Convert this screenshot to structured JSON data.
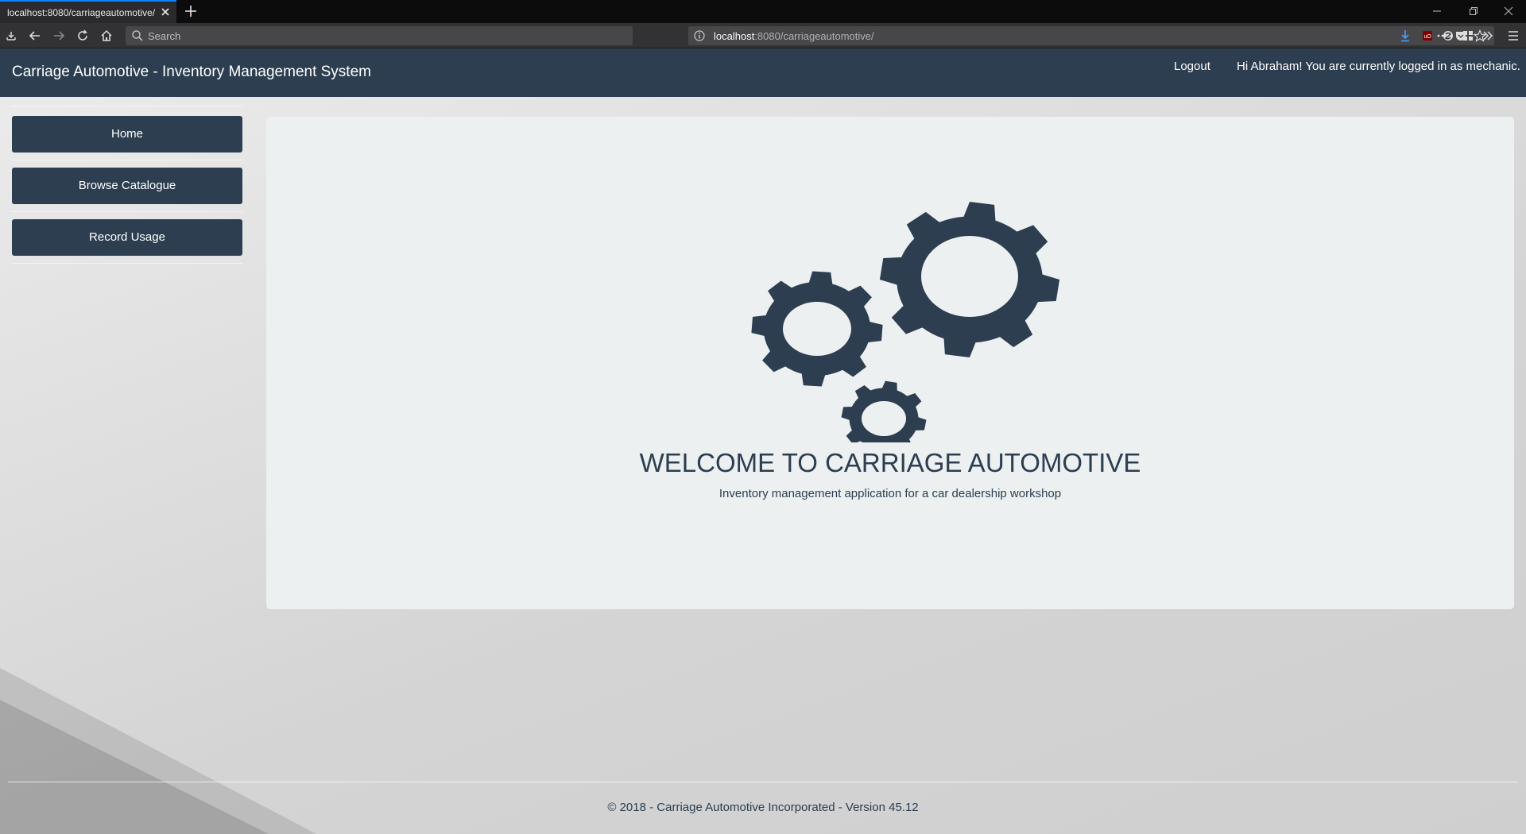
{
  "browser": {
    "tab_title": "localhost:8080/carriageautomotive/",
    "search_placeholder": "Search",
    "url_host": "localhost",
    "url_rest": ":8080/carriageautomotive/"
  },
  "header": {
    "title": "Carriage Automotive - Inventory Management System",
    "logout_label": "Logout",
    "greeting": "Hi Abraham! You are currently logged in as mechanic."
  },
  "sidebar": {
    "items": [
      {
        "label": "Home"
      },
      {
        "label": "Browse Catalogue"
      },
      {
        "label": "Record Usage"
      }
    ]
  },
  "main": {
    "heading": "WELCOME TO CARRIAGE AUTOMOTIVE",
    "subheading": "Inventory management application for a car dealership workshop",
    "illustration": "gears-icon"
  },
  "footer": {
    "text": "© 2018 - Carriage Automotive Incorporated - Version 45.12"
  },
  "colors": {
    "primary": "#2c3e50",
    "panel": "#ecf0f1"
  }
}
